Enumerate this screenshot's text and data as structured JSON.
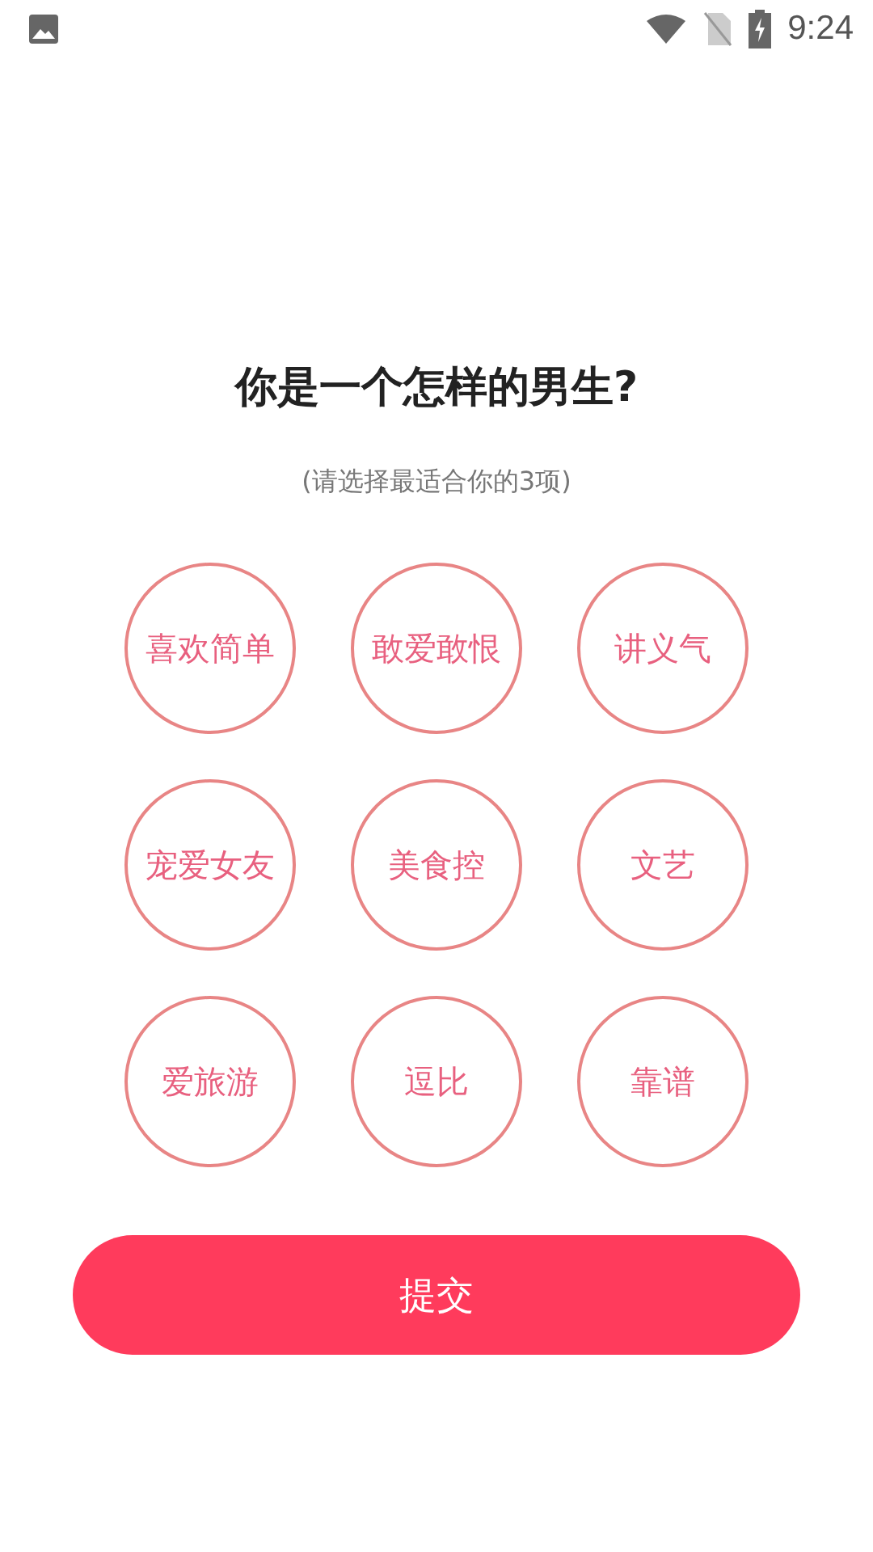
{
  "status_bar": {
    "time": "9:24"
  },
  "title": "你是一个怎样的男生?",
  "subtitle": "(请选择最适合你的3项)",
  "options": [
    {
      "label": "喜欢简单",
      "selected": false
    },
    {
      "label": "敢爱敢恨",
      "selected": false
    },
    {
      "label": "讲义气",
      "selected": false
    },
    {
      "label": "宠爱女友",
      "selected": false
    },
    {
      "label": "美食控",
      "selected": false
    },
    {
      "label": "文艺",
      "selected": false
    },
    {
      "label": "爱旅游",
      "selected": false
    },
    {
      "label": "逗比",
      "selected": false
    },
    {
      "label": "靠谱",
      "selected": false
    }
  ],
  "submit_button": "提交"
}
